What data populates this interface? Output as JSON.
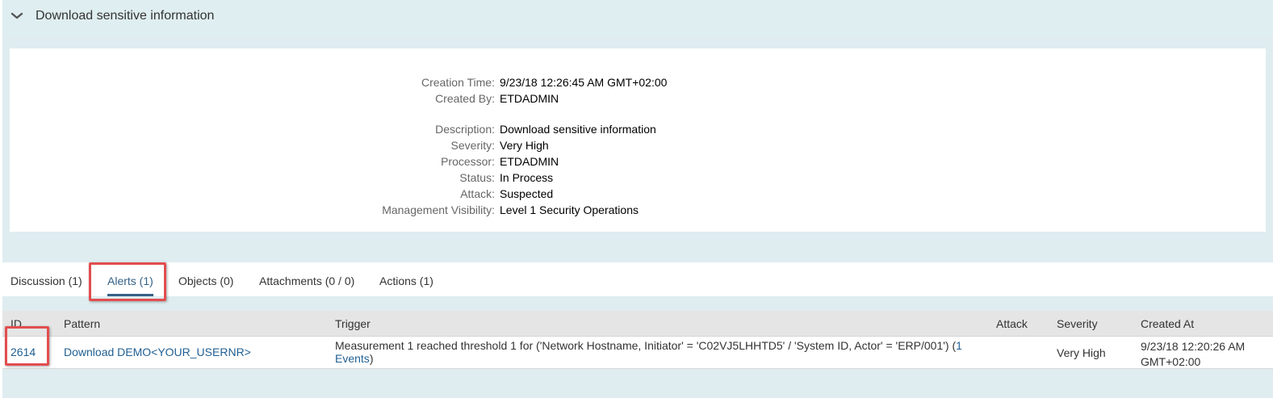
{
  "header": {
    "title": "Download sensitive information",
    "icon": "chevron-down-icon"
  },
  "details": {
    "creation_time": {
      "label": "Creation Time:",
      "value": "9/23/18 12:26:45 AM GMT+02:00"
    },
    "created_by": {
      "label": "Created By:",
      "value": "ETDADMIN"
    },
    "description": {
      "label": "Description:",
      "value": "Download sensitive information"
    },
    "severity": {
      "label": "Severity:",
      "value": "Very High"
    },
    "processor": {
      "label": "Processor:",
      "value": "ETDADMIN"
    },
    "status": {
      "label": "Status:",
      "value": "In Process"
    },
    "attack": {
      "label": "Attack:",
      "value": "Suspected"
    },
    "management_visibility": {
      "label": "Management Visibility:",
      "value": "Level 1 Security Operations"
    }
  },
  "tabs": [
    {
      "label": "Discussion (1)",
      "selected": false
    },
    {
      "label": "Alerts (1)",
      "selected": true
    },
    {
      "label": "Objects (0)",
      "selected": false
    },
    {
      "label": "Attachments (0 / 0)",
      "selected": false
    },
    {
      "label": "Actions (1)",
      "selected": false
    }
  ],
  "table": {
    "columns": [
      "ID",
      "Pattern",
      "Trigger",
      "Attack",
      "Severity",
      "Created At"
    ],
    "rows": [
      {
        "id": "2614",
        "pattern": "Download DEMO<YOUR_USERNR>",
        "trigger_text": "Measurement 1 reached threshold 1 for ('Network Hostname, Initiator' = 'C02VJ5LHHTD5' / 'System ID, Actor' = 'ERP/001') (",
        "trigger_link_1": "1",
        "trigger_link_2": "Events",
        "trigger_close": ")",
        "attack": "",
        "severity": "Very High",
        "created_at_line1": "9/23/18 12:20:26 AM",
        "created_at_line2": "GMT+02:00"
      }
    ]
  },
  "colors": {
    "accent": "#346187",
    "link": "#1f5f93",
    "highlight": "#e24d4f",
    "background": "#dfedf0"
  }
}
